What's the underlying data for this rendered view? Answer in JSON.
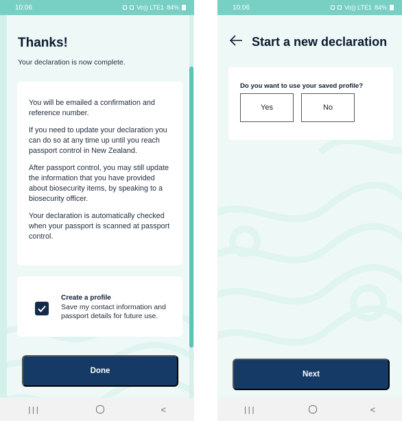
{
  "left": {
    "status": {
      "time": "10:06",
      "network": "Vo)) LTE1",
      "battery": "84%"
    },
    "title": "Thanks!",
    "subtitle": "Your declaration is now complete.",
    "info_paragraphs": [
      "You will be emailed a confirmation and reference number.",
      "If you need to update your declaration you can do so at any time up until you reach passport control in New Zealand.",
      "After passport control, you may still update the information that you have provided about biosecurity items, by speaking to a biosecurity officer.",
      "Your declaration is automatically checked when your passport is scanned at passport control."
    ],
    "profile": {
      "checked": true,
      "title": "Create a profile",
      "description": "Save my contact information and passport details for future use."
    },
    "done_label": "Done"
  },
  "right": {
    "status": {
      "time": "10:06",
      "network": "Vo)) LTE1",
      "battery": "84%"
    },
    "title": "Start a new declaration",
    "question": "Do you want to use your saved profile?",
    "yes_label": "Yes",
    "no_label": "No",
    "next_label": "Next"
  },
  "nav": {
    "recent": "|||",
    "back": "<"
  },
  "colors": {
    "accent_teal": "#78cfc4",
    "primary_navy": "#153a66",
    "background": "#eef9f7"
  },
  "icons": {
    "back": "back-arrow-icon",
    "check": "check-icon",
    "home": "home-circle-icon"
  }
}
